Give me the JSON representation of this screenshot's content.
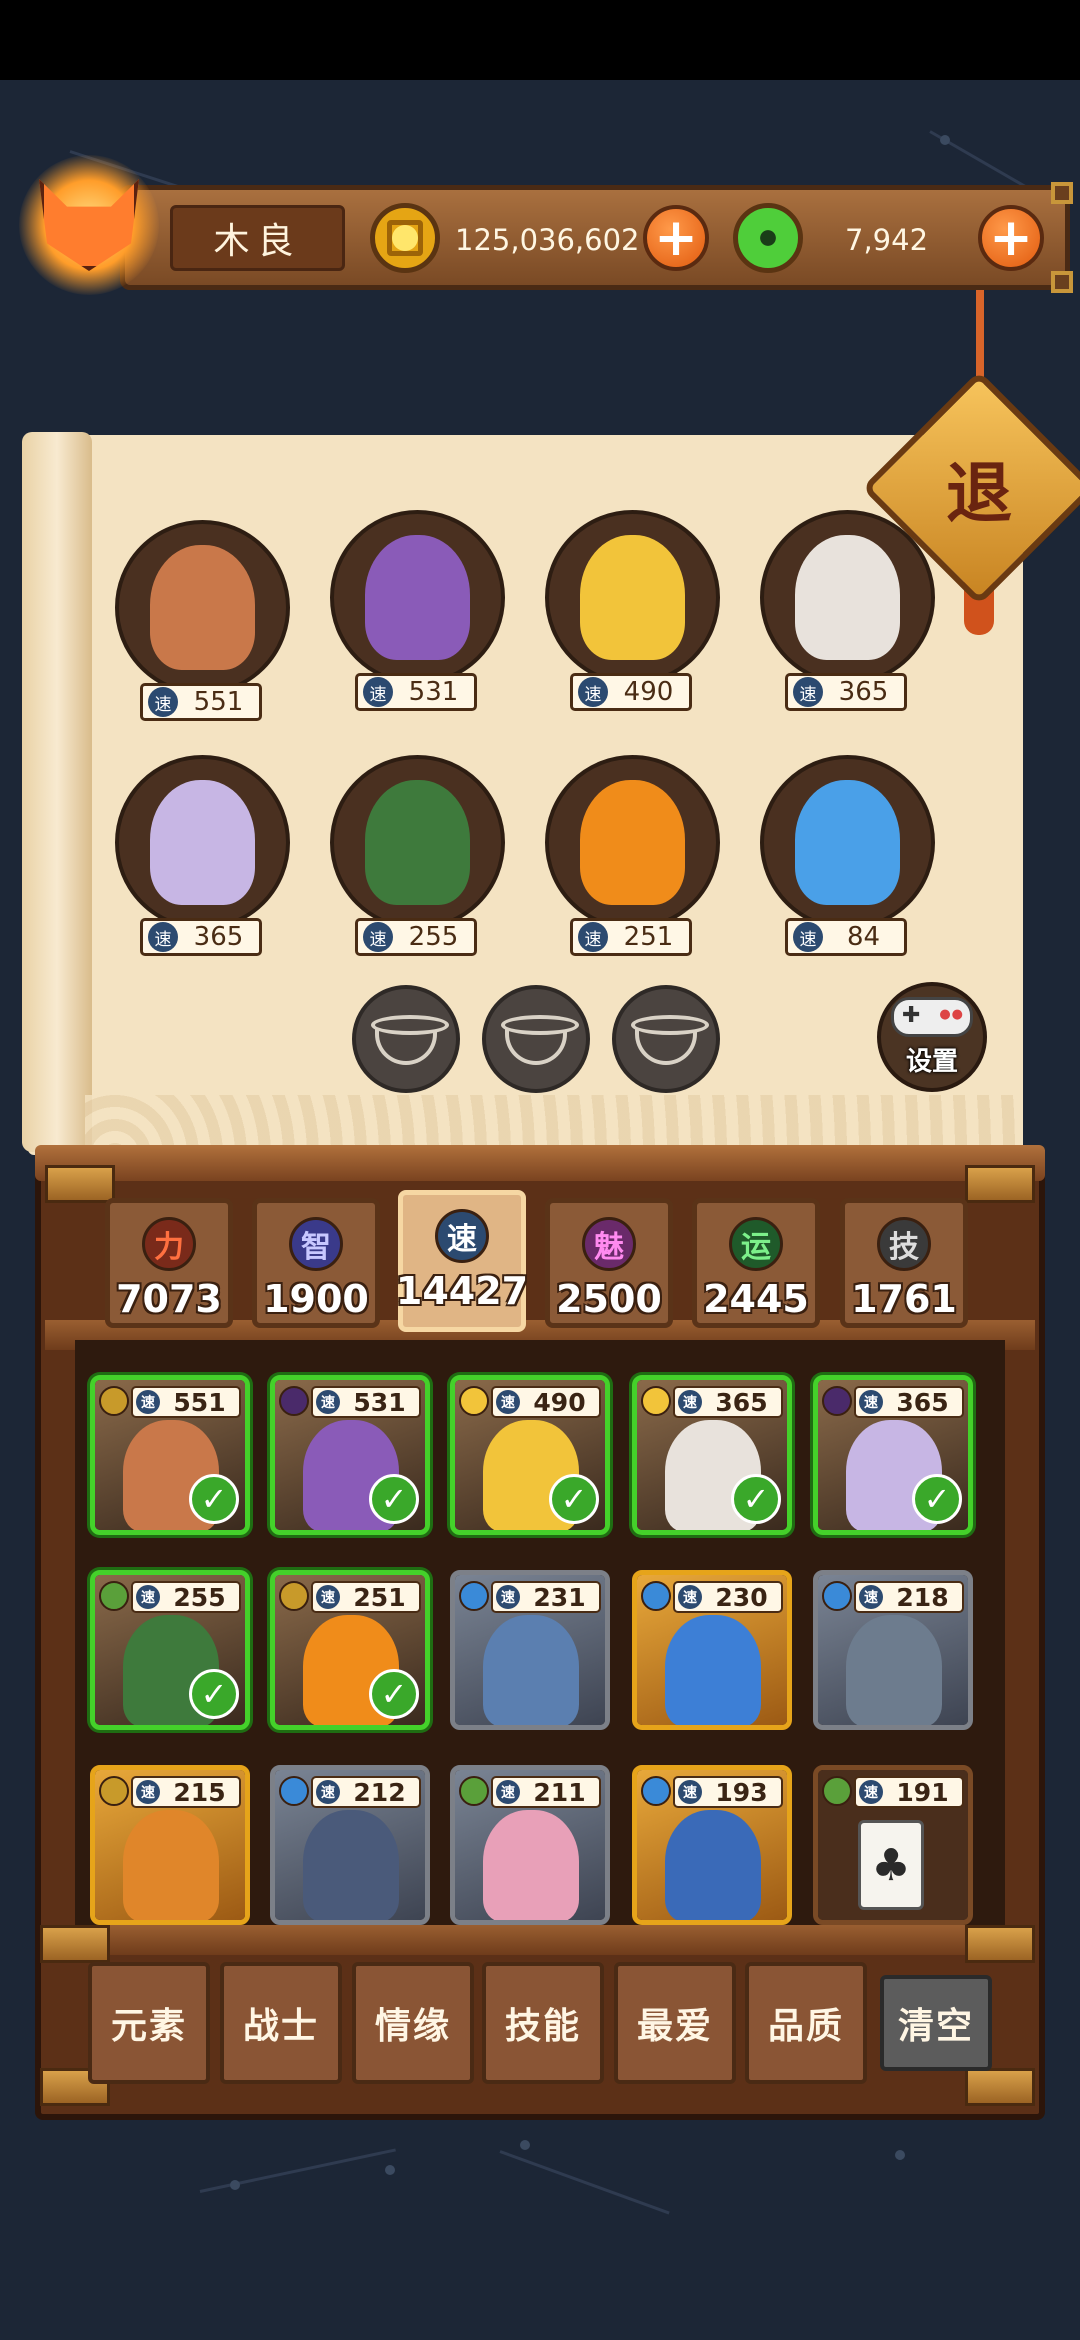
{
  "player": {
    "name": "木良",
    "avatar_icon": "fox-mask-icon"
  },
  "currency": {
    "gold": {
      "icon": "gold-coin-icon",
      "amount": "125,036,602",
      "add_label": "+"
    },
    "jade": {
      "icon": "jade-coin-icon",
      "amount": "7,942",
      "add_label": "+"
    }
  },
  "exit_button": {
    "label": "退"
  },
  "lineup": {
    "speed_label": "速",
    "heroes": [
      {
        "speed": "551",
        "color": "#c9784a"
      },
      {
        "speed": "531",
        "color": "#8a5bb8"
      },
      {
        "speed": "490",
        "color": "#f2c43a"
      },
      {
        "speed": "365",
        "color": "#e8e2dc"
      },
      {
        "speed": "365",
        "color": "#c7b6e4"
      },
      {
        "speed": "255",
        "color": "#3e7a3c"
      },
      {
        "speed": "251",
        "color": "#f08c1a"
      },
      {
        "speed": "84",
        "color": "#4aa0e8"
      }
    ],
    "empty_slots": 3,
    "settings_label": "设置"
  },
  "stats": [
    {
      "badge": "力",
      "value": "7073",
      "badge_color": "#7a2a1a",
      "text_color": "#ff7040",
      "active": false
    },
    {
      "badge": "智",
      "value": "1900",
      "badge_color": "#3a3a8a",
      "text_color": "#c8c8ff",
      "active": false
    },
    {
      "badge": "速",
      "value": "14427",
      "badge_color": "#2c4a70",
      "text_color": "#ffffff",
      "active": true
    },
    {
      "badge": "魅",
      "value": "2500",
      "badge_color": "#6a2a6a",
      "text_color": "#ff8af0",
      "active": false
    },
    {
      "badge": "运",
      "value": "2445",
      "badge_color": "#1f5a2a",
      "text_color": "#7cf08a",
      "active": false
    },
    {
      "badge": "技",
      "value": "1761",
      "badge_color": "#3a3a3a",
      "text_color": "#dddddd",
      "active": false
    }
  ],
  "roster": [
    {
      "speed": "551",
      "element": "#c89a2a",
      "style": "selected",
      "color": "#c9784a",
      "checked": true
    },
    {
      "speed": "531",
      "element": "#4a2a6a",
      "style": "selected",
      "color": "#8a5bb8",
      "checked": true
    },
    {
      "speed": "490",
      "element": "#f2c43a",
      "style": "selected",
      "color": "#f2c43a",
      "checked": true
    },
    {
      "speed": "365",
      "element": "#f2c43a",
      "style": "selected",
      "color": "#e8e2dc",
      "checked": true
    },
    {
      "speed": "365",
      "element": "#4a2a6a",
      "style": "selected",
      "color": "#c7b6e4",
      "checked": true
    },
    {
      "speed": "255",
      "element": "#5aa03a",
      "style": "selected",
      "color": "#3e7a3c",
      "checked": true
    },
    {
      "speed": "251",
      "element": "#c89a2a",
      "style": "selected",
      "color": "#f08c1a",
      "checked": true
    },
    {
      "speed": "231",
      "element": "#3a8ad8",
      "style": "gray",
      "color": "#5b7fb0",
      "checked": false
    },
    {
      "speed": "230",
      "element": "#3a8ad8",
      "style": "gold",
      "color": "#3d7fd6",
      "checked": false
    },
    {
      "speed": "218",
      "element": "#3a8ad8",
      "style": "gray",
      "color": "#6d7c8e",
      "checked": false
    },
    {
      "speed": "215",
      "element": "#c89a2a",
      "style": "gold",
      "color": "#e0862a",
      "checked": false
    },
    {
      "speed": "212",
      "element": "#3a8ad8",
      "style": "gray",
      "color": "#4a5a7a",
      "checked": false
    },
    {
      "speed": "211",
      "element": "#5aa03a",
      "style": "gray",
      "color": "#e8a0b8",
      "checked": false
    },
    {
      "speed": "193",
      "element": "#3a8ad8",
      "style": "gold",
      "color": "#3a6ab8",
      "checked": false
    },
    {
      "speed": "191",
      "element": "#5aa03a",
      "style": "brown",
      "color": "tile",
      "checked": false
    }
  ],
  "filters": [
    {
      "label": "元素"
    },
    {
      "label": "战士"
    },
    {
      "label": "情缘"
    },
    {
      "label": "技能"
    },
    {
      "label": "最爱"
    },
    {
      "label": "品质"
    },
    {
      "label": "清空"
    }
  ]
}
